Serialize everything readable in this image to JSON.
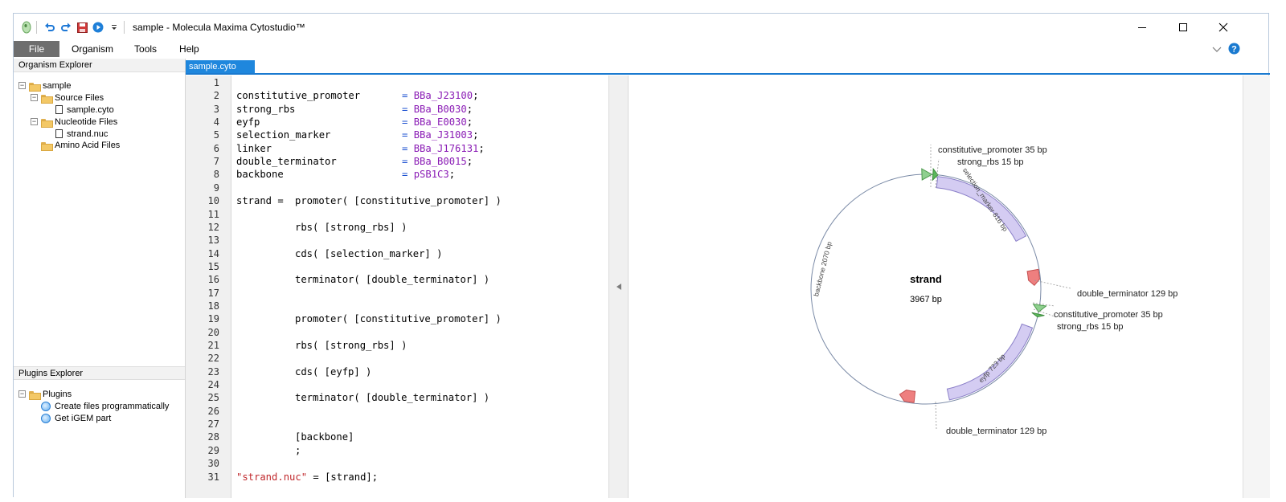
{
  "window": {
    "title": "sample - Molecula Maxima Cytostudio™",
    "controls": [
      "minimize",
      "maximize",
      "close"
    ]
  },
  "menu": {
    "items": [
      "File",
      "Organism",
      "Tools",
      "Help"
    ]
  },
  "organism_explorer": {
    "header": "Organism Explorer",
    "tree": {
      "root": "sample",
      "source_files": "Source Files",
      "source_file_1": "sample.cyto",
      "nucleotide_files": "Nucleotide Files",
      "nucleotide_file_1": "strand.nuc",
      "amino_acid_files": "Amino Acid Files"
    }
  },
  "plugins_explorer": {
    "header": "Plugins Explorer",
    "root": "Plugins",
    "items": [
      "Create files programmatically",
      "Get iGEM part"
    ]
  },
  "tabs": [
    "sample.cyto"
  ],
  "editor": {
    "line_numbers": [
      "1",
      "2",
      "3",
      "4",
      "5",
      "6",
      "7",
      "8",
      "9",
      "10",
      "11",
      "12",
      "13",
      "14",
      "15",
      "16",
      "17",
      "18",
      "19",
      "20",
      "21",
      "22",
      "23",
      "24",
      "25",
      "26",
      "27",
      "28",
      "29",
      "30",
      "31"
    ],
    "defs": [
      {
        "name": "constitutive_promoter",
        "value": "BBa_J23100"
      },
      {
        "name": "strong_rbs",
        "value": "BBa_B0030"
      },
      {
        "name": "eyfp",
        "value": "BBa_E0030"
      },
      {
        "name": "selection_marker",
        "value": "BBa_J31003"
      },
      {
        "name": "linker",
        "value": "BBa_J176131"
      },
      {
        "name": "double_terminator",
        "value": "BBa_B0015"
      },
      {
        "name": "backbone",
        "value": "pSB1C3"
      }
    ],
    "strand_assign": "strand =",
    "body": {
      "l10": "promoter( [constitutive_promoter] )",
      "l12": "rbs( [strong_rbs] )",
      "l14": "cds( [selection_marker] )",
      "l16": "terminator( [double_terminator] )",
      "l19": "promoter( [constitutive_promoter] )",
      "l21": "rbs( [strong_rbs] )",
      "l23": "cds( [eyfp] )",
      "l25": "terminator( [double_terminator] )",
      "l28": "[backbone]",
      "l29": ";",
      "l31_str": "\"strand.nuc\"",
      "l31_rest": " = [strand];"
    }
  },
  "plasmid": {
    "name": "strand",
    "length": "3967 bp",
    "labels": {
      "top_promoter": "constitutive_promoter 35 bp",
      "top_rbs": "strong_rbs 15 bp",
      "right_terminator": "double_terminator 129 bp",
      "right_promoter": "constitutive_promoter 35 bp",
      "right_rbs": "strong_rbs 15 bp",
      "bottom_terminator": "double_terminator 129 bp",
      "selection_marker_arc": "selection_marker 816 bp",
      "eyfp_arc": "eyfp 723 bp",
      "backbone_arc": "backbone 2070 bp"
    },
    "colors": {
      "promoter": "#8fd08f",
      "rbs": "#5bb85b",
      "cds": "#d4ccf2",
      "terminator": "#ee7f7f",
      "ring": "#7a8aa6"
    }
  }
}
